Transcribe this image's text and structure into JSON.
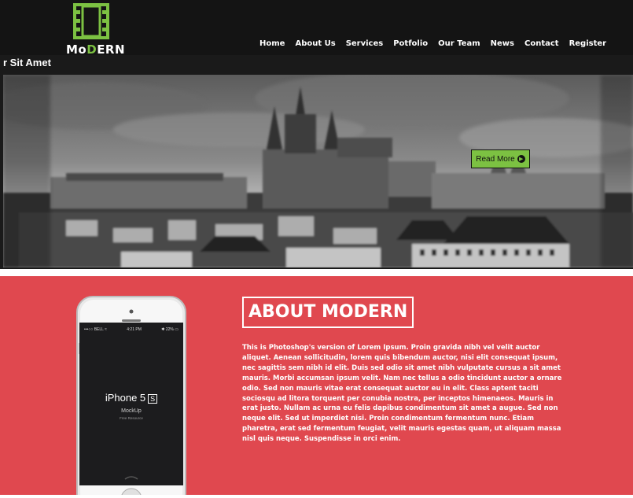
{
  "header": {
    "logo": {
      "text_pre": "Mo",
      "text_accent": "D",
      "text_post": "ERN"
    },
    "nav": [
      {
        "label": "Home"
      },
      {
        "label": "About Us"
      },
      {
        "label": "Services"
      },
      {
        "label": "Potfolio"
      },
      {
        "label": "Our Team"
      },
      {
        "label": "News"
      },
      {
        "label": "Contact"
      },
      {
        "label": "Register"
      }
    ]
  },
  "slider": {
    "caption": "r Sit Amet",
    "read_more": "Read More",
    "arrow_icon": "circle-arrow-right-icon"
  },
  "about": {
    "title": "ABOUT MODERN",
    "body": "This is Photoshop's version of Lorem Ipsum. Proin gravida nibh vel velit auctor aliquet. Aenean sollicitudin, lorem quis bibendum auctor, nisi elit consequat ipsum, nec sagittis sem nibh id elit. Duis sed odio sit amet nibh vulputate cursus a sit amet mauris. Morbi accumsan ipsum velit. Nam nec tellus a odio tincidunt auctor a ornare odio. Sed non mauris vitae erat consequat auctor eu in elit. Class aptent taciti sociosqu ad litora torquent per conubia nostra, per inceptos himenaeos. Mauris in erat justo. Nullam ac urna eu felis dapibus condimentum sit amet a augue. Sed non neque elit. Sed ut imperdiet nisi. Proin condimentum fermentum nunc. Etiam pharetra, erat sed fermentum feugiat, velit mauris egestas quam, ut aliquam massa nisl quis neque. Suspendisse in orci enim.",
    "phone": {
      "carrier": "BELL",
      "time": "4:21 PM",
      "battery": "22%",
      "model": "iPhone 5",
      "model_badge": "S",
      "subtitle": "MockUp",
      "subtitle2": "Free Resource"
    }
  },
  "colors": {
    "accent_green": "#7cc142",
    "about_bg": "#e0484f",
    "header_bg": "#141414"
  }
}
